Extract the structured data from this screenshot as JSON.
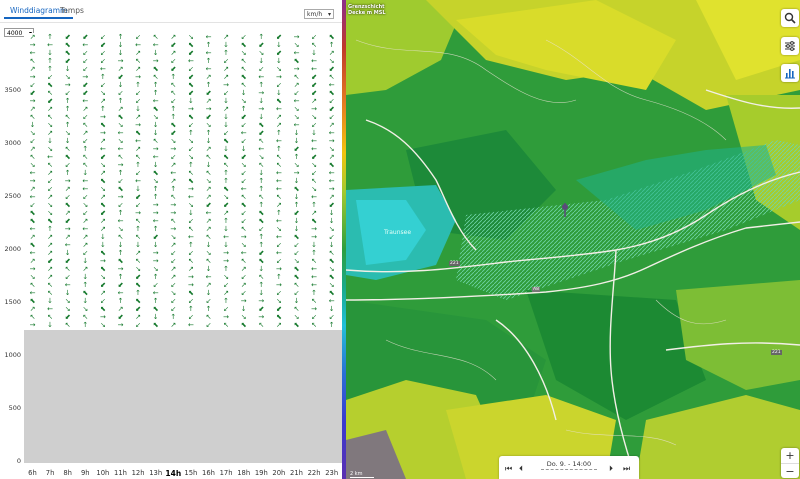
{
  "tabs": [
    {
      "label": "Winddiagramm"
    },
    {
      "label": "Temps"
    }
  ],
  "unit": "km/h",
  "altitude_select": "4000",
  "y_ticks": [
    "3500",
    "3000",
    "2500",
    "2000",
    "1500",
    "1000",
    "500",
    "0"
  ],
  "hours": [
    "6h",
    "7h",
    "8h",
    "9h",
    "10h",
    "11h",
    "12h",
    "13h",
    "14h",
    "15h",
    "16h",
    "17h",
    "18h",
    "19h",
    "20h",
    "21h",
    "22h",
    "23h"
  ],
  "selected_hour": "14h",
  "map": {
    "legend_title": "Grenzschicht Decke m MSL",
    "place_labels": [
      "Traunsee",
      "A8",
      "221"
    ],
    "road_label_right": "221",
    "scale": "2 km"
  },
  "timebar": {
    "date": "Do. 9. - 14:00"
  },
  "zoom": {
    "plus": "+",
    "minus": "−"
  }
}
